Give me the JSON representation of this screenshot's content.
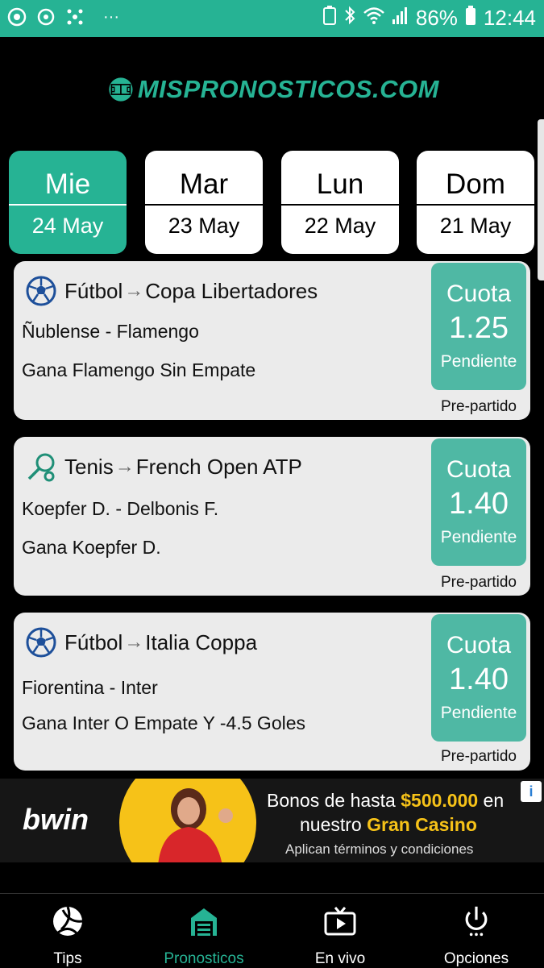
{
  "status_bar": {
    "battery": "86%",
    "time": "12:44",
    "dots": "···"
  },
  "logo": {
    "text": "MISPRONOSTICOS.COM"
  },
  "days": [
    {
      "day": "Mie",
      "date": "24 May",
      "active": true
    },
    {
      "day": "Mar",
      "date": "23 May",
      "active": false
    },
    {
      "day": "Lun",
      "date": "22 May",
      "active": false
    },
    {
      "day": "Dom",
      "date": "21 May",
      "active": false
    }
  ],
  "tips": [
    {
      "sport": "Fútbol",
      "sport_icon": "soccer-ball-icon",
      "arrow": "→",
      "competition": "Copa Libertadores",
      "match": "Ñublense - Flamengo",
      "pick": "Gana Flamengo Sin Empate",
      "odds_label": "Cuota",
      "odds": "1.25",
      "status": "Pendiente",
      "timing": "Pre-partido"
    },
    {
      "sport": "Tenis",
      "sport_icon": "tennis-racket-icon",
      "arrow": "→",
      "competition": "French Open ATP",
      "match": "Koepfer D. - Delbonis F.",
      "pick": "Gana Koepfer D.",
      "odds_label": "Cuota",
      "odds": "1.40",
      "status": "Pendiente",
      "timing": "Pre-partido"
    },
    {
      "sport": "Fútbol",
      "sport_icon": "soccer-ball-icon",
      "arrow": "→",
      "competition": "Italia Coppa",
      "match": "Fiorentina  - Inter",
      "pick": "Gana Inter O Empate Y -4.5 Goles",
      "odds_label": "Cuota",
      "odds": "1.40",
      "status": "Pendiente",
      "timing": "Pre-partido"
    }
  ],
  "ad": {
    "brand": "bwin",
    "line1_a": "Bonos de hasta ",
    "line1_b": "$500.000",
    "line1_c": " en",
    "line2_a": "nuestro ",
    "line2_b": "Gran Casino",
    "terms": "Aplican términos y condiciones",
    "info": "i"
  },
  "nav": [
    {
      "label": "Tips",
      "icon": "volleyball-icon",
      "active": false
    },
    {
      "label": "Pronosticos",
      "icon": "garage-icon",
      "active": true
    },
    {
      "label": "En vivo",
      "icon": "tv-play-icon",
      "active": false
    },
    {
      "label": "Opciones",
      "icon": "power-icon",
      "active": false
    }
  ],
  "colors": {
    "accent": "#26b394",
    "odds_box": "#4fb8a4",
    "card_bg": "#ebebeb",
    "ad_highlight": "#f6c218"
  }
}
